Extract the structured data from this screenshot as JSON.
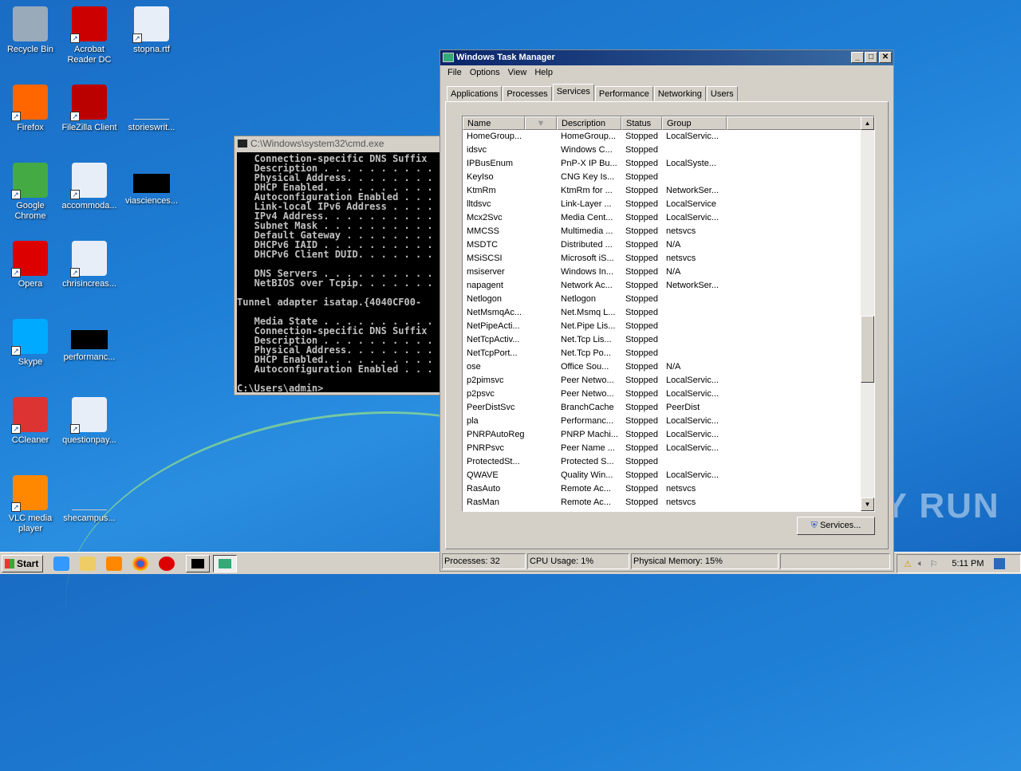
{
  "desktop": {
    "icons": [
      {
        "label": "Recycle Bin",
        "icon": "recycle-bin-icon",
        "color": "#9ab"
      },
      {
        "label": "Acrobat Reader DC",
        "icon": "acrobat-icon",
        "color": "#c00"
      },
      {
        "label": "stopna.rtf",
        "icon": "word-doc-icon",
        "color": "#e8eef8"
      },
      {
        "label": "Firefox",
        "icon": "firefox-icon",
        "color": "#f60"
      },
      {
        "label": "FileZilla Client",
        "icon": "filezilla-icon",
        "color": "#b00"
      },
      {
        "label": "storieswrit...",
        "icon": "blank-file-icon",
        "color": "transparent"
      },
      {
        "label": "Google Chrome",
        "icon": "chrome-icon",
        "color": "#4a4"
      },
      {
        "label": "accommoda...",
        "icon": "word-doc-icon",
        "color": "#e8eef8"
      },
      {
        "label": "viasciences...",
        "icon": "black-file-icon",
        "color": "#000"
      },
      {
        "label": "Opera",
        "icon": "opera-icon",
        "color": "#d00"
      },
      {
        "label": "chrisincreas...",
        "icon": "word-doc-icon",
        "color": "#e8eef8"
      },
      {
        "label": "Skype",
        "icon": "skype-icon",
        "color": "#0af"
      },
      {
        "label": "performanc...",
        "icon": "black-file-icon",
        "color": "#000"
      },
      {
        "label": "CCleaner",
        "icon": "ccleaner-icon",
        "color": "#d33"
      },
      {
        "label": "questionpay...",
        "icon": "word-doc-icon",
        "color": "#e8eef8"
      },
      {
        "label": "VLC media player",
        "icon": "vlc-icon",
        "color": "#f80"
      },
      {
        "label": "shecampus...",
        "icon": "blank-file-icon",
        "color": "transparent"
      }
    ]
  },
  "cmd": {
    "title": "C:\\Windows\\system32\\cmd.exe",
    "lines": [
      "   Connection-specific DNS Suffix",
      "   Description . . . . . . . . . .",
      "   Physical Address. . . . . . . .",
      "   DHCP Enabled. . . . . . . . . .",
      "   Autoconfiguration Enabled . . .",
      "   Link-local IPv6 Address . . . .",
      "   IPv4 Address. . . . . . . . . .",
      "   Subnet Mask . . . . . . . . . .",
      "   Default Gateway . . . . . . . .",
      "   DHCPv6 IAID . . . . . . . . . .",
      "   DHCPv6 Client DUID. . . . . . .",
      "",
      "   DNS Servers . . . . . . . . . .",
      "   NetBIOS over Tcpip. . . . . . .",
      "",
      "Tunnel adapter isatap.{4040CF00-",
      "",
      "   Media State . . . . . . . . . .",
      "   Connection-specific DNS Suffix",
      "   Description . . . . . . . . . .",
      "   Physical Address. . . . . . . .",
      "   DHCP Enabled. . . . . . . . . .",
      "   Autoconfiguration Enabled . . .",
      "",
      "C:\\Users\\admin>"
    ]
  },
  "taskmgr": {
    "title": "Windows Task Manager",
    "menu": [
      "File",
      "Options",
      "View",
      "Help"
    ],
    "tabs": [
      "Applications",
      "Processes",
      "Services",
      "Performance",
      "Networking",
      "Users"
    ],
    "active_tab": "Services",
    "columns": [
      "Name",
      "Description",
      "Status",
      "Group"
    ],
    "rows": [
      [
        "HomeGroup...",
        "HomeGroup...",
        "Stopped",
        "LocalServic..."
      ],
      [
        "idsvc",
        "Windows C...",
        "Stopped",
        ""
      ],
      [
        "IPBusEnum",
        "PnP-X IP Bu...",
        "Stopped",
        "LocalSyste..."
      ],
      [
        "KeyIso",
        "CNG Key Is...",
        "Stopped",
        ""
      ],
      [
        "KtmRm",
        "KtmRm for ...",
        "Stopped",
        "NetworkSer..."
      ],
      [
        "lltdsvc",
        "Link-Layer ...",
        "Stopped",
        "LocalService"
      ],
      [
        "Mcx2Svc",
        "Media Cent...",
        "Stopped",
        "LocalServic..."
      ],
      [
        "MMCSS",
        "Multimedia ...",
        "Stopped",
        "netsvcs"
      ],
      [
        "MSDTC",
        "Distributed ...",
        "Stopped",
        "N/A"
      ],
      [
        "MSiSCSI",
        "Microsoft iS...",
        "Stopped",
        "netsvcs"
      ],
      [
        "msiserver",
        "Windows In...",
        "Stopped",
        "N/A"
      ],
      [
        "napagent",
        "Network Ac...",
        "Stopped",
        "NetworkSer..."
      ],
      [
        "Netlogon",
        "Netlogon",
        "Stopped",
        ""
      ],
      [
        "NetMsmqAc...",
        "Net.Msmq L...",
        "Stopped",
        ""
      ],
      [
        "NetPipeActi...",
        "Net.Pipe Lis...",
        "Stopped",
        ""
      ],
      [
        "NetTcpActiv...",
        "Net.Tcp Lis...",
        "Stopped",
        ""
      ],
      [
        "NetTcpPort...",
        "Net.Tcp Po...",
        "Stopped",
        ""
      ],
      [
        "ose",
        "Office  Sou...",
        "Stopped",
        "N/A"
      ],
      [
        "p2pimsvc",
        "Peer Netwo...",
        "Stopped",
        "LocalServic..."
      ],
      [
        "p2psvc",
        "Peer Netwo...",
        "Stopped",
        "LocalServic..."
      ],
      [
        "PeerDistSvc",
        "BranchCache",
        "Stopped",
        "PeerDist"
      ],
      [
        "pla",
        "Performanc...",
        "Stopped",
        "LocalServic..."
      ],
      [
        "PNRPAutoReg",
        "PNRP Machi...",
        "Stopped",
        "LocalServic..."
      ],
      [
        "PNRPsvc",
        "Peer Name ...",
        "Stopped",
        "LocalServic..."
      ],
      [
        "ProtectedSt...",
        "Protected S...",
        "Stopped",
        ""
      ],
      [
        "QWAVE",
        "Quality Win...",
        "Stopped",
        "LocalServic..."
      ],
      [
        "RasAuto",
        "Remote Ac...",
        "Stopped",
        "netsvcs"
      ],
      [
        "RasMan",
        "Remote Ac...",
        "Stopped",
        "netsvcs"
      ]
    ],
    "services_button": "Services...",
    "status": {
      "processes": "Processes: 32",
      "cpu": "CPU Usage: 1%",
      "memory": "Physical Memory: 15%"
    }
  },
  "taskbar": {
    "start": "Start",
    "clock": "5:11 PM"
  },
  "watermark": "ANY RUN"
}
